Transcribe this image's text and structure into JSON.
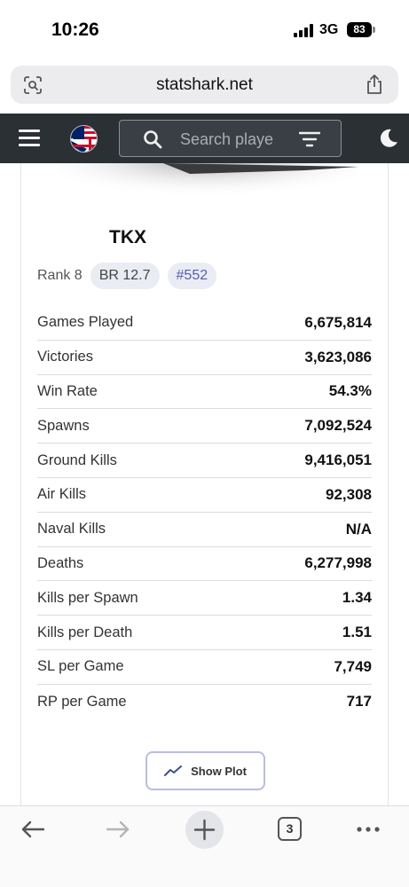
{
  "status_bar": {
    "time": "10:26",
    "network": "3G",
    "battery": "83"
  },
  "browser": {
    "url": "statshark.net",
    "tab_count": "3"
  },
  "navbar": {
    "search_placeholder": "Search playe",
    "icons": [
      "hamburger-menu-icon",
      "uk-usa-flag-icon",
      "search-icon",
      "filter-icon",
      "moon-icon"
    ]
  },
  "vehicle": {
    "name": "TKX",
    "rank": "Rank 8",
    "br": "BR 12.7",
    "position": "#552"
  },
  "stats": [
    {
      "label": "Games Played",
      "value": "6,675,814"
    },
    {
      "label": "Victories",
      "value": "3,623,086"
    },
    {
      "label": "Win Rate",
      "value": "54.3%"
    },
    {
      "label": "Spawns",
      "value": "7,092,524"
    },
    {
      "label": "Ground Kills",
      "value": "9,416,051"
    },
    {
      "label": "Air Kills",
      "value": "92,308"
    },
    {
      "label": "Naval Kills",
      "value": "N/A"
    },
    {
      "label": "Deaths",
      "value": "6,277,998"
    },
    {
      "label": "Kills per Spawn",
      "value": "1.34"
    },
    {
      "label": "Kills per Death",
      "value": "1.51"
    },
    {
      "label": "SL per Game",
      "value": "7,749"
    },
    {
      "label": "RP per Game",
      "value": "717"
    }
  ],
  "actions": {
    "show_plot": "Show Plot"
  },
  "colors": {
    "navbar_bg": "#2b3035",
    "badge_bg": "#e9ecf3",
    "badge_accent": "#5b5cb1",
    "plot_border": "#b9bce6"
  }
}
